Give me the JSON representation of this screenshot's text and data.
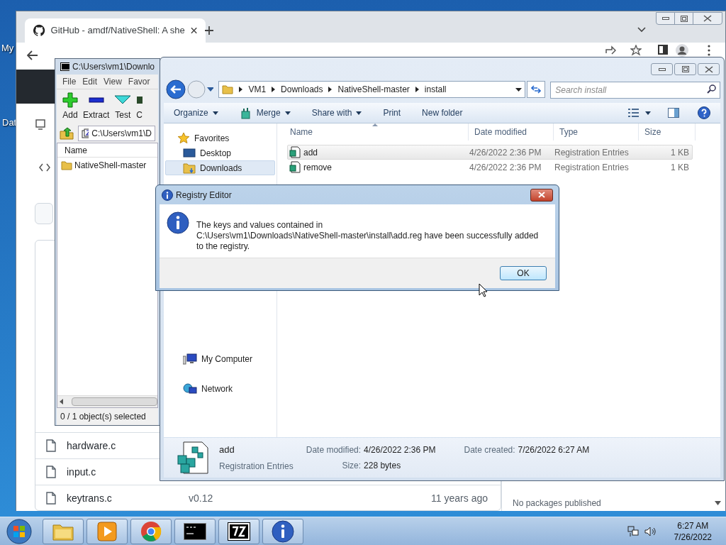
{
  "desktop_icons": [
    {
      "label": "My"
    },
    {
      "label": "Dat"
    }
  ],
  "browser": {
    "tab": {
      "title": "GitHub - amdf/NativeShell: A she"
    },
    "files": [
      {
        "name": "hardware.c"
      },
      {
        "name": "input.c"
      },
      {
        "name": "keytrans.c",
        "message": "v0.12",
        "age": "11 years ago"
      }
    ],
    "packages_note": "No packages published"
  },
  "archiver": {
    "title": "C:\\Users\\vm1\\Downlo",
    "menu": [
      "File",
      "Edit",
      "View",
      "Favor"
    ],
    "toolbar": [
      {
        "label": "Add",
        "kind": "add"
      },
      {
        "label": "Extract",
        "kind": "extract"
      },
      {
        "label": "Test",
        "kind": "test"
      },
      {
        "label": "C",
        "kind": "other"
      }
    ],
    "path": "C:\\Users\\vm1\\D",
    "column": "Name",
    "rows": [
      {
        "name": "NativeShell-master"
      }
    ],
    "status": "0 / 1 object(s) selected"
  },
  "explorer": {
    "breadcrumb": [
      "VM1",
      "Downloads",
      "NativeShell-master",
      "install"
    ],
    "search": {
      "placeholder": "Search install"
    },
    "commands": [
      {
        "label": "Organize",
        "dropdown": true,
        "kind": "plain"
      },
      {
        "label": "Merge",
        "dropdown": true,
        "kind": "merge"
      },
      {
        "label": "Share with",
        "dropdown": true,
        "kind": "plain"
      },
      {
        "label": "Print",
        "dropdown": false,
        "kind": "plain"
      },
      {
        "label": "New folder",
        "dropdown": false,
        "kind": "plain"
      }
    ],
    "nav_top": [
      {
        "label": "Favorites",
        "kind": "star",
        "selected": false
      },
      {
        "label": "Desktop",
        "kind": "desktop",
        "selected": false
      },
      {
        "label": "Downloads",
        "kind": "downloads",
        "selected": true
      }
    ],
    "nav_bottom": [
      {
        "label": "My Computer",
        "kind": "computer",
        "selected": false
      },
      {
        "label": "Network",
        "kind": "network",
        "selected": false
      }
    ],
    "columns": [
      "Name",
      "Date modified",
      "Type",
      "Size"
    ],
    "files": [
      {
        "name": "add",
        "date": "4/26/2022 2:36 PM",
        "type": "Registration Entries",
        "size": "1 KB",
        "selected": true
      },
      {
        "name": "remove",
        "date": "4/26/2022 2:36 PM",
        "type": "Registration Entries",
        "size": "1 KB",
        "selected": false
      }
    ],
    "details": {
      "name": "add",
      "type": "Registration Entries",
      "modified_label": "Date modified:",
      "modified": "4/26/2022 2:36 PM",
      "size_label": "Size:",
      "size": "228 bytes",
      "created_label": "Date created:",
      "created": "7/26/2022 6:27 AM"
    }
  },
  "dialog": {
    "title": "Registry Editor",
    "message": "The keys and values contained in C:\\Users\\vm1\\Downloads\\NativeShell-master\\install\\add.reg have been successfully added to the registry.",
    "button": "OK"
  },
  "taskbar": {
    "apps": [
      {
        "kind": "folder"
      },
      {
        "kind": "media"
      },
      {
        "kind": "chrome"
      },
      {
        "kind": "console"
      },
      {
        "kind": "archiver"
      },
      {
        "kind": "info"
      }
    ],
    "time": "6:27 AM",
    "date": "7/26/2022"
  }
}
